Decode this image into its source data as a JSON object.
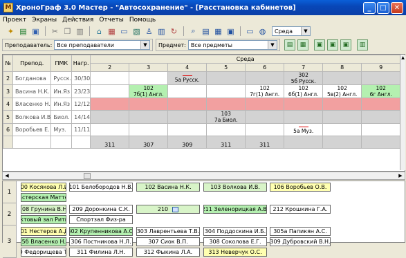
{
  "window": {
    "title": "ХроноГраф 3.0 Мастер - \"Автосохранение\" - [Расстановка кабинетов]"
  },
  "menu": [
    "Проект",
    "Экраны",
    "Действия",
    "Отчеты",
    "Помощь"
  ],
  "toolbar": {
    "day_combo": "Среда"
  },
  "filters": {
    "teacher_label": "Преподаватель:",
    "teacher_value": "Все преподаватели",
    "subject_label": "Предмет:",
    "subject_value": "Все предметы"
  },
  "grid": {
    "headers": {
      "num": "№",
      "teacher": "Препод.",
      "pmk": "ПМК",
      "load": "Нагр.",
      "day": "Среда"
    },
    "lessons": [
      "2",
      "3",
      "4",
      "5",
      "6",
      "7",
      "8",
      "9"
    ],
    "rows": [
      {
        "n": "2",
        "name": "Богданова",
        "pmk": "Русск.",
        "load": "30/30",
        "cells": [
          {
            "t": "",
            "c": "w"
          },
          {
            "t": "",
            "c": "w"
          },
          {
            "t": "5а Русск.",
            "c": "cl",
            "mark": true
          },
          {
            "t": "",
            "c": "cl"
          },
          {
            "t": "",
            "c": "cl"
          },
          {
            "t": "302|5б Русск.",
            "c": "cl"
          },
          {
            "t": "",
            "c": "cl"
          },
          {
            "t": "",
            "c": "cl"
          }
        ]
      },
      {
        "n": "3",
        "name": "Васина Н.К.",
        "pmk": "Ин.Яз",
        "load": "23/23",
        "cells": [
          {
            "t": "",
            "c": "w"
          },
          {
            "t": "102|7б(1) Англ.",
            "c": "gr"
          },
          {
            "t": "",
            "c": "w"
          },
          {
            "t": "",
            "c": "w"
          },
          {
            "t": "102|7г(1) Англ.",
            "c": "w"
          },
          {
            "t": "102|6б(1) Англ.",
            "c": "w"
          },
          {
            "t": "102|5в(2) Англ.",
            "c": "w"
          },
          {
            "t": "102|6г Англ.",
            "c": "gr"
          }
        ]
      },
      {
        "n": "4",
        "name": "Власенко Н.",
        "pmk": "Ин.Яз",
        "load": "12/12",
        "cells": [
          {
            "t": "",
            "c": "rd"
          },
          {
            "t": "",
            "c": "rd"
          },
          {
            "t": "",
            "c": "rd"
          },
          {
            "t": "",
            "c": "rd"
          },
          {
            "t": "",
            "c": "rd"
          },
          {
            "t": "",
            "c": "rd"
          },
          {
            "t": "",
            "c": "rd"
          },
          {
            "t": "",
            "c": "rd"
          }
        ]
      },
      {
        "n": "5",
        "name": "Волкова И.В",
        "pmk": "Биол.",
        "load": "14/14",
        "cells": [
          {
            "t": "",
            "c": "cl"
          },
          {
            "t": "",
            "c": "cl"
          },
          {
            "t": "",
            "c": "cl"
          },
          {
            "t": "103|7а Биол.",
            "c": "cl"
          },
          {
            "t": "",
            "c": "cl"
          },
          {
            "t": "",
            "c": "cl"
          },
          {
            "t": "",
            "c": "cl"
          },
          {
            "t": "",
            "c": "cl"
          }
        ]
      },
      {
        "n": "6",
        "name": "Воробьев Е.",
        "pmk": "Муз.",
        "load": "11/11",
        "cells": [
          {
            "t": "",
            "c": "w"
          },
          {
            "t": "",
            "c": "w"
          },
          {
            "t": "",
            "c": "w"
          },
          {
            "t": "",
            "c": "w"
          },
          {
            "t": "",
            "c": "w"
          },
          {
            "t": "5а Муз.",
            "c": "w",
            "mark": true
          },
          {
            "t": "",
            "c": "w"
          },
          {
            "t": "",
            "c": "w"
          }
        ]
      }
    ],
    "partial_row": [
      "311",
      "307",
      "309",
      "311",
      "311"
    ]
  },
  "rooms": {
    "floors": [
      {
        "label": "1",
        "rows": [
          [
            {
              "t": "100 Косякова Л.И.",
              "c": "y"
            },
            {
              "t": "101 Белобородов Н.В.",
              "c": "w"
            },
            {
              "t": "102 Васина Н.К.",
              "c": "l"
            },
            {
              "t": "103 Волкова И.В.",
              "c": "l"
            },
            {
              "t": "106 Воробьев О.В.",
              "c": "y"
            }
          ],
          [
            {
              "t": "Мастерская Маттех.",
              "c": "g"
            }
          ]
        ]
      },
      {
        "label": "2",
        "rows": [
          [
            {
              "t": "208 Грунина В.Н.",
              "c": "l"
            },
            {
              "t": "209 Доронкина С.К.",
              "c": "w"
            },
            {
              "t": "210",
              "c": "l",
              "pc": true
            },
            {
              "t": "211 Зеленорицкая А.В.",
              "c": "g"
            },
            {
              "t": "212 Крошкина Г.А.",
              "c": "w"
            }
          ],
          [
            {
              "t": "Актовый зал Ритм.",
              "c": "g"
            },
            {
              "t": "Спортзал Физ-ра",
              "c": "w"
            }
          ]
        ]
      },
      {
        "label": "3",
        "rows": [
          [
            {
              "t": "301 Нестеров А.Д.",
              "c": "y"
            },
            {
              "t": "302 Крупенникова А.С.",
              "c": "g"
            },
            {
              "t": "303 Лаврентьева Т.В.",
              "c": "w"
            },
            {
              "t": "304 Поддоскина И.Б.",
              "c": "w"
            },
            {
              "t": "305а Папикян А.С.",
              "c": "w"
            }
          ],
          [
            {
              "t": "305б Власенко Н.М.",
              "c": "g"
            },
            {
              "t": "306 Постникова Н.Л.",
              "c": "w"
            },
            {
              "t": "307 Сиок В.П.",
              "c": "w"
            },
            {
              "t": "308 Соколова Е.Г.",
              "c": "w"
            },
            {
              "t": "309 Дубровский В.Н.",
              "c": "w"
            }
          ],
          [
            {
              "t": "310 Федорищева Т.Д.",
              "c": "w"
            },
            {
              "t": "311 Филина Л.Н.",
              "c": "w"
            },
            {
              "t": "312 Фыкина Л.А.",
              "c": "w"
            },
            {
              "t": "313 Неверчук О.С.",
              "c": "y"
            }
          ]
        ]
      }
    ]
  }
}
